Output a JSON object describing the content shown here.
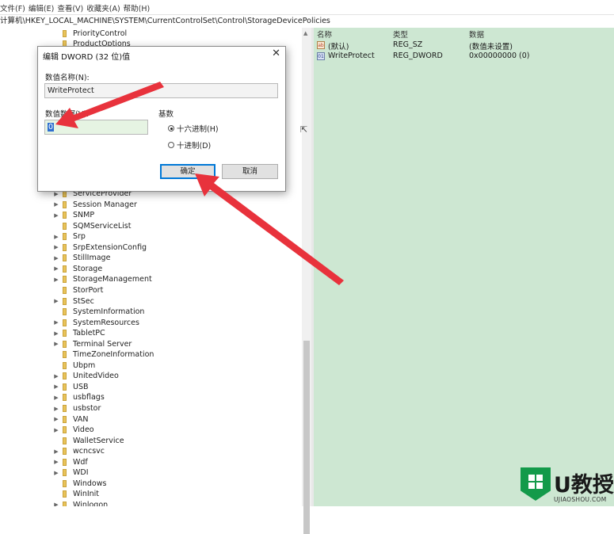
{
  "menubar": {
    "items": [
      "文件(F)",
      "编辑(E)",
      "查看(V)",
      "收藏夹(A)",
      "帮助(H)"
    ]
  },
  "address": {
    "path": "计算机\\HKEY_LOCAL_MACHINE\\SYSTEM\\CurrentControlSet\\Control\\StorageDevicePolicies"
  },
  "tree": {
    "items": [
      {
        "label": "PriorityControl",
        "expandable": false
      },
      {
        "label": "ProductOptions",
        "expandable": false
      },
      {
        "label": "ServiceProvider",
        "expandable": true
      },
      {
        "label": "Session Manager",
        "expandable": true
      },
      {
        "label": "SNMP",
        "expandable": true
      },
      {
        "label": "SQMServiceList",
        "expandable": false
      },
      {
        "label": "Srp",
        "expandable": true
      },
      {
        "label": "SrpExtensionConfig",
        "expandable": true
      },
      {
        "label": "StillImage",
        "expandable": true
      },
      {
        "label": "Storage",
        "expandable": true
      },
      {
        "label": "StorageManagement",
        "expandable": true
      },
      {
        "label": "StorPort",
        "expandable": false
      },
      {
        "label": "StSec",
        "expandable": true
      },
      {
        "label": "SystemInformation",
        "expandable": false
      },
      {
        "label": "SystemResources",
        "expandable": true
      },
      {
        "label": "TabletPC",
        "expandable": true
      },
      {
        "label": "Terminal Server",
        "expandable": true
      },
      {
        "label": "TimeZoneInformation",
        "expandable": false
      },
      {
        "label": "Ubpm",
        "expandable": false
      },
      {
        "label": "UnitedVideo",
        "expandable": true
      },
      {
        "label": "USB",
        "expandable": true
      },
      {
        "label": "usbflags",
        "expandable": true
      },
      {
        "label": "usbstor",
        "expandable": true
      },
      {
        "label": "VAN",
        "expandable": true
      },
      {
        "label": "Video",
        "expandable": true
      },
      {
        "label": "WalletService",
        "expandable": false
      },
      {
        "label": "wcncsvc",
        "expandable": true
      },
      {
        "label": "Wdf",
        "expandable": true
      },
      {
        "label": "WDI",
        "expandable": true
      },
      {
        "label": "Windows",
        "expandable": false
      },
      {
        "label": "WinInit",
        "expandable": false
      },
      {
        "label": "Winlogon",
        "expandable": true
      }
    ]
  },
  "values_pane": {
    "headers": {
      "name": "名称",
      "type": "类型",
      "data": "数据"
    },
    "rows": [
      {
        "icon": "string-value-icon",
        "name": "(默认)",
        "type": "REG_SZ",
        "data": "(数值未设置)"
      },
      {
        "icon": "dword-value-icon",
        "name": "WriteProtect",
        "type": "REG_DWORD",
        "data": "0x00000000 (0)"
      }
    ],
    "background": "#cde7d2"
  },
  "dialog": {
    "title": "编辑 DWORD (32 位)值",
    "name_label": "数值名称(N):",
    "name_value": "WriteProtect",
    "data_label": "数值数据(V):",
    "data_value": "0",
    "base_label": "基数",
    "hex_label": "十六进制(H)",
    "dec_label": "十进制(D)",
    "selected_base": "hex",
    "ok_label": "确定",
    "cancel_label": "取消"
  },
  "logo": {
    "brand": "U教授",
    "domain": "UJIAOSHOU.COM",
    "color": "#139a4a"
  },
  "annotation_color": "#e8323c"
}
